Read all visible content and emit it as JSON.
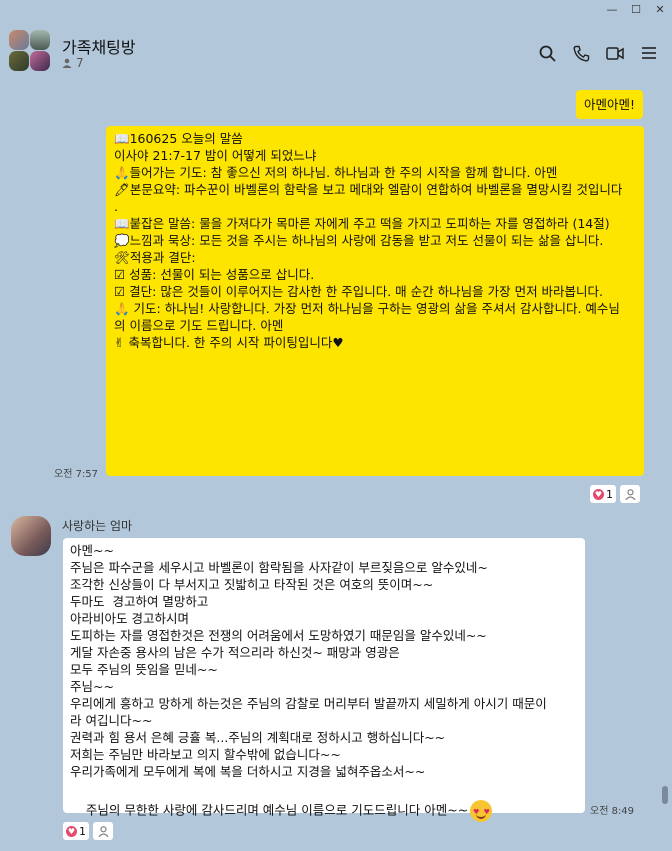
{
  "window": {
    "min": "—",
    "max": "☐",
    "close": "✕"
  },
  "chat": {
    "title": "가족채팅방",
    "member_count": "7"
  },
  "messages": {
    "sent_short": {
      "text": "아멘아멘!"
    },
    "devotion": {
      "time": "오전 7:57",
      "lines": [
        "📖160625 오늘의 말씀",
        "이사야 21:7-17 밤이 어떻게 되었느냐",
        "",
        "🙏들어가는 기도: 참 좋으신 저의 하나님. 하나님과 한 주의 시작을 함께 합니다. 아멘",
        "",
        "🖊본문요약: 파수꾼이 바벨론의 함락을 보고 메대와 엘람이 연합하여 바벨론을 멸망시킬 것입니다",
        ".",
        "",
        "📖붙잡은 말씀: 물을 가져다가 목마른 자에게 주고 떡을 가지고 도피하는 자를 영접하라 (14절)",
        "",
        "💭느낌과 묵상: 모든 것을 주시는 하나님의 사랑에 감동을 받고 저도 선물이 되는 삶을 삽니다.",
        "",
        "🛠적용과 결단:",
        "☑ 성품: 선물이 되는 성품으로 삽니다.",
        "☑ 결단: 많은 것들이 이루어지는 감사한 한 주입니다. 매 순간 하나님을 가장 먼저 바라봅니다.",
        "",
        "🙏 기도: 하나님! 사랑합니다. 가장 먼저 하나님을 구하는 영광의 삶을 주셔서 감사합니다. 예수님",
        "의 이름으로 기도 드립니다. 아멘",
        "",
        "✌ 축복합니다. 한 주의 시작 파이팅입니다♥"
      ],
      "reaction_count": "1"
    },
    "mom": {
      "sender": "사랑하는 엄마",
      "time": "오전 8:49",
      "lines": [
        "아멘~~",
        "주님은 파수군을 세우시고 바벨론이 함락됨을 사자같이 부르짖음으로 알수있네~",
        "조각한 신상들이 다 부서지고 짓밟히고 타작된 것은 여호의 뜻이며~~",
        "두마도  경고하여 멸망하고",
        "아라비아도 경고하시며",
        "도피하는 자를 영접한것은 전쟁의 어려움에서 도망하였기 때문임을 알수있네~~",
        "게달 자손중 용사의 남은 수가 적으리라 하신것~ 패망과 영광은",
        "모두 주님의 뜻임을 믿네~~",
        "주님~~",
        "우리에게 흥하고 망하게 하는것은 주님의 감찰로 머리부터 발끝까지 세밀하게 아시기 때문이",
        "라 여깁니다~~",
        "권력과 힘 용서 은혜 긍휼 복...주님의 계획대로 정하시고 행하십니다~~",
        "저희는 주님만 바라보고 의지 할수밖에 없습니다~~",
        "우리가족에게 모두에게 복에 복을 더하시고 지경을 넓혀주옵소서~~",
        "주님의 무한한 사랑에 감사드리며 예수님 이름으로 기도드립니다 아멘~~"
      ],
      "reaction_count": "1"
    }
  },
  "icons": {
    "search": "search-icon",
    "call": "phone-icon",
    "video": "video-icon",
    "menu": "menu-icon",
    "emoji": "heart-eyes-emoji"
  },
  "colors": {
    "background": "#b2c7da",
    "my_bubble": "#fee500",
    "other_bubble": "#ffffff",
    "heart": "#e24a6e"
  }
}
